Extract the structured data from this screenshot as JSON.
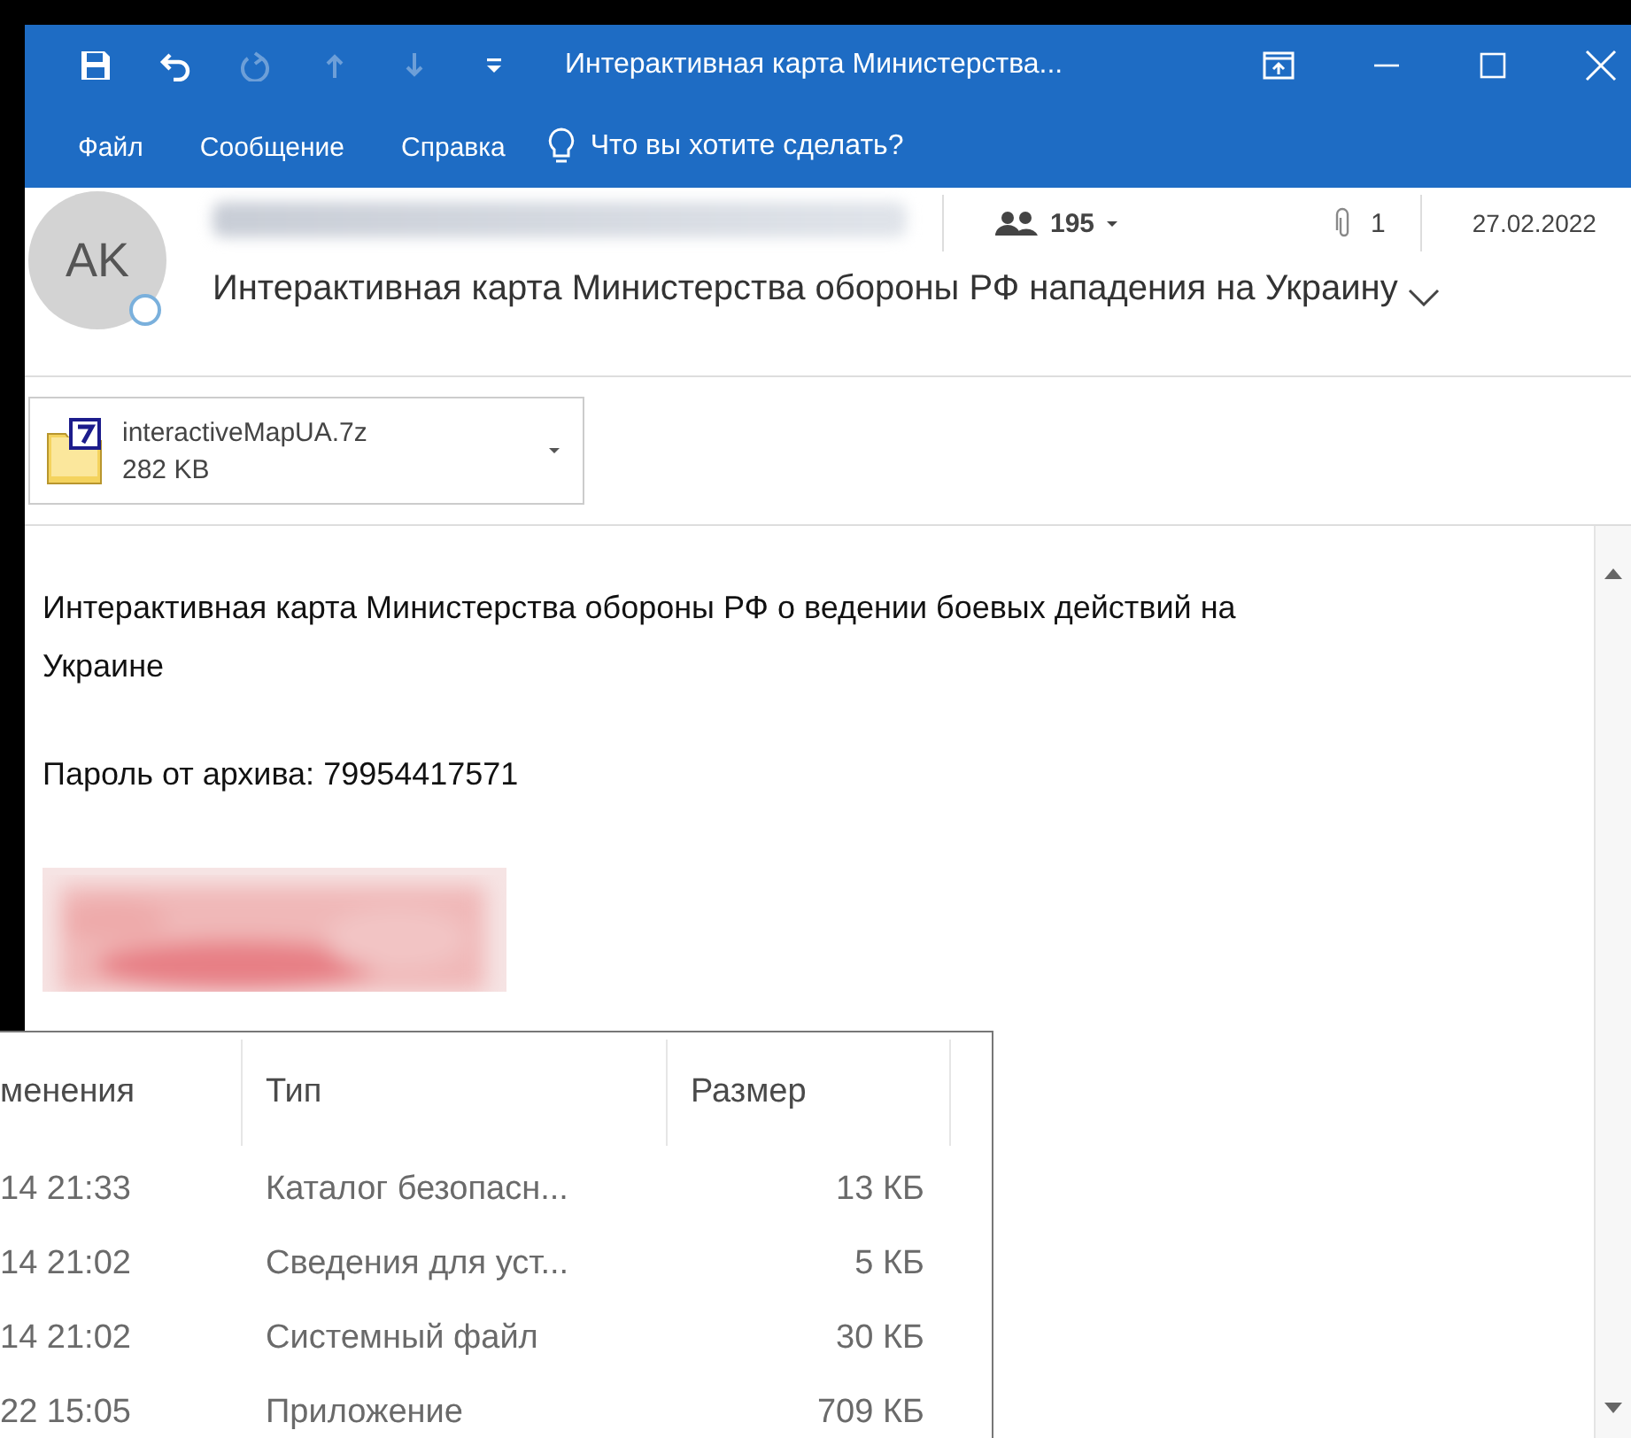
{
  "window": {
    "title": "Интерактивная карта Министерства...",
    "quick_access": [
      {
        "kind": "save",
        "disabled": false
      },
      {
        "kind": "undo",
        "disabled": false
      },
      {
        "kind": "redo",
        "disabled": true
      },
      {
        "kind": "up",
        "disabled": true
      },
      {
        "kind": "down",
        "disabled": true
      },
      {
        "kind": "customize",
        "disabled": false
      }
    ]
  },
  "menu": [
    {
      "label": "Файл"
    },
    {
      "label": "Сообщение"
    },
    {
      "label": "Справка"
    }
  ],
  "tell_me": {
    "placeholder": "Что вы хотите сделать?"
  },
  "message": {
    "avatar": "AK",
    "recipients": "195",
    "attachments_count": "1",
    "date": "27.02.2022",
    "subject": "Интерактивная карта Министерства обороны РФ нападения на Украину",
    "attachment": {
      "name": "interactiveMapUA.7z",
      "size": "282 KB"
    },
    "body": [
      "Интерактивная карта Министерства обороны РФ о ведении боевых действий на Украине",
      "Пароль от архива: 79954417571"
    ]
  },
  "file_list": {
    "columns": [
      "менения",
      "Тип",
      "Размер"
    ],
    "rows": [
      {
        "modified": "14 21:33",
        "type": "Каталог безопасн...",
        "size": "13 КБ"
      },
      {
        "modified": "14 21:02",
        "type": "Сведения для уст...",
        "size": "5 КБ"
      },
      {
        "modified": "14 21:02",
        "type": "Системный файл",
        "size": "30 КБ"
      },
      {
        "modified": "22 15:05",
        "type": "Приложение",
        "size": "709 КБ"
      }
    ]
  }
}
